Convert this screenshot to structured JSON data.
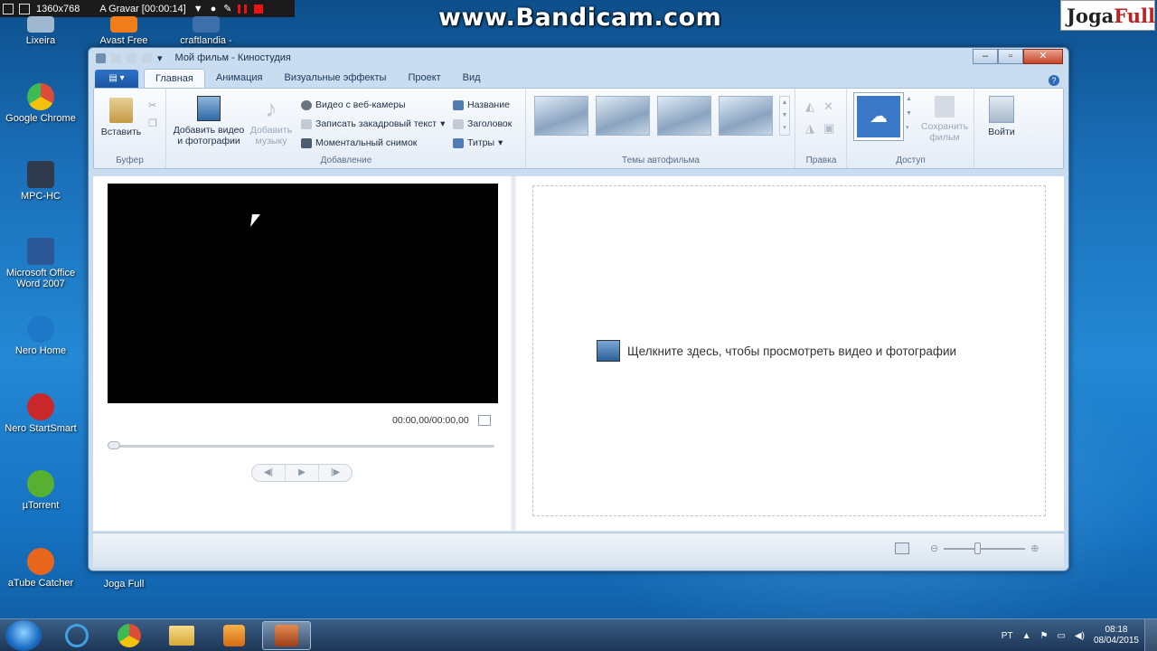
{
  "recorder": {
    "resolution": "1360x768",
    "status": "A Gravar [00:00:14]"
  },
  "watermark": "www.Bandicam.com",
  "logo": {
    "part1": "Joga",
    "part2": "Full"
  },
  "desktop_icons": [
    {
      "label": "Lixeira",
      "color": "#9fb8d0"
    },
    {
      "label": "Avast Free",
      "color": "#f07d1a"
    },
    {
      "label": "craftlandia -",
      "color": "#3d6fa8"
    },
    {
      "label": "Google Chrome",
      "color": "#dd4b39"
    },
    {
      "label": "MPC-HC",
      "color": "#303a4d"
    },
    {
      "label": "Microsoft Office Word 2007",
      "color": "#2b5797"
    },
    {
      "label": "Nero Home",
      "color": "#1e78c8"
    },
    {
      "label": "Nero StartSmart",
      "color": "#c8282a"
    },
    {
      "label": "µTorrent",
      "color": "#58b031"
    },
    {
      "label": "aTube Catcher",
      "color": "#e8651c"
    },
    {
      "label": "Joga Full",
      "color": "#b0542a"
    }
  ],
  "window": {
    "title": "Мой фильм - Киностудия",
    "tabs": [
      "Главная",
      "Анимация",
      "Визуальные эффекты",
      "Проект",
      "Вид"
    ],
    "ribbon": {
      "paste": "Вставить",
      "clipboard_group": "Буфер",
      "add_video": "Добавить видео",
      "add_video2": "и фотографии",
      "add_music": "Добавить",
      "add_music2": "музыку",
      "webcam": "Видео с веб-камеры",
      "narration": "Записать закадровый текст",
      "snapshot": "Моментальный снимок",
      "title": "Название",
      "caption": "Заголовок",
      "credits": "Титры",
      "add_group": "Добавление",
      "themes_group": "Темы автофильма",
      "edit_group": "Правка",
      "save_movie": "Сохранить",
      "save_movie2": "фильм",
      "share_group": "Доступ",
      "signin": "Войти"
    },
    "player": {
      "time": "00:00,00/00:00,00"
    },
    "storyboard_hint": "Щелкните здесь, чтобы просмотреть видео и фотографии"
  },
  "taskbar": {
    "lang": "PT",
    "time": "08:18",
    "date": "08/04/2015"
  },
  "colors": {
    "accent": "#1a55a3",
    "desktop": "#1a6fb8"
  }
}
